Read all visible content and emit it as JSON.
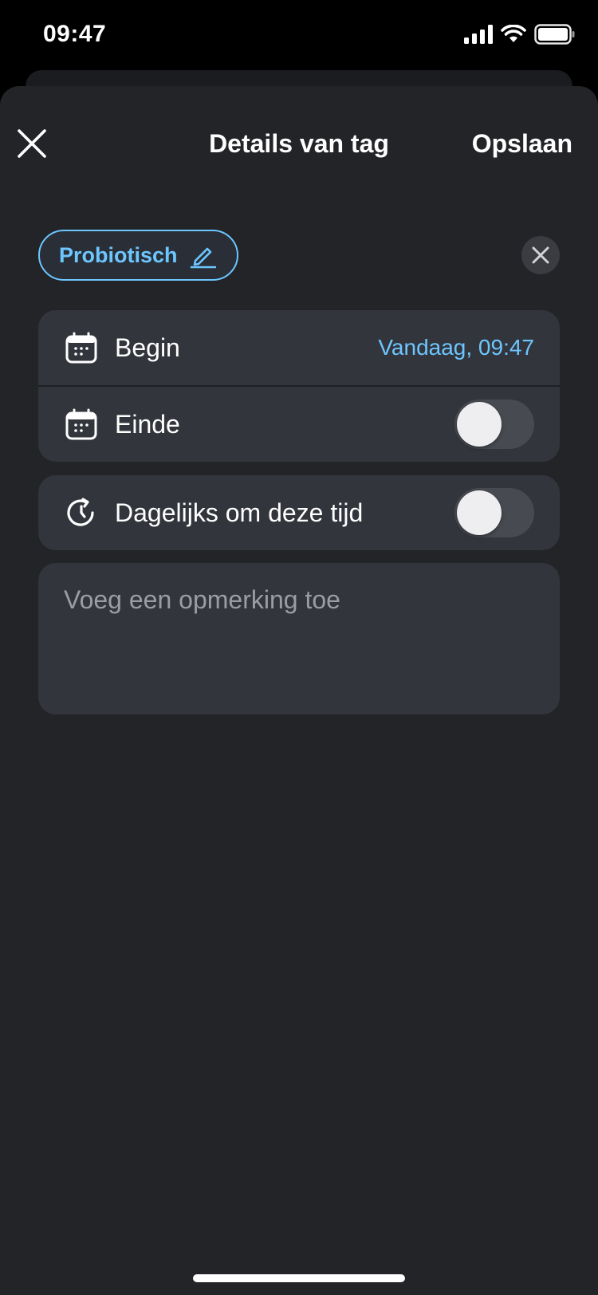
{
  "status_bar": {
    "time": "09:47"
  },
  "header": {
    "title": "Details van tag",
    "save_label": "Opslaan"
  },
  "tag": {
    "name": "Probiotisch"
  },
  "schedule": {
    "begin": {
      "label": "Begin",
      "value": "Vandaag, 09:47"
    },
    "end": {
      "label": "Einde",
      "enabled": false
    }
  },
  "repeat": {
    "label": "Dagelijks om deze tijd",
    "enabled": false
  },
  "note": {
    "placeholder": "Voeg een opmerking toe"
  },
  "colors": {
    "accent": "#6cc7ff",
    "sheet_background": "#232428",
    "card_background": "#33353c"
  }
}
